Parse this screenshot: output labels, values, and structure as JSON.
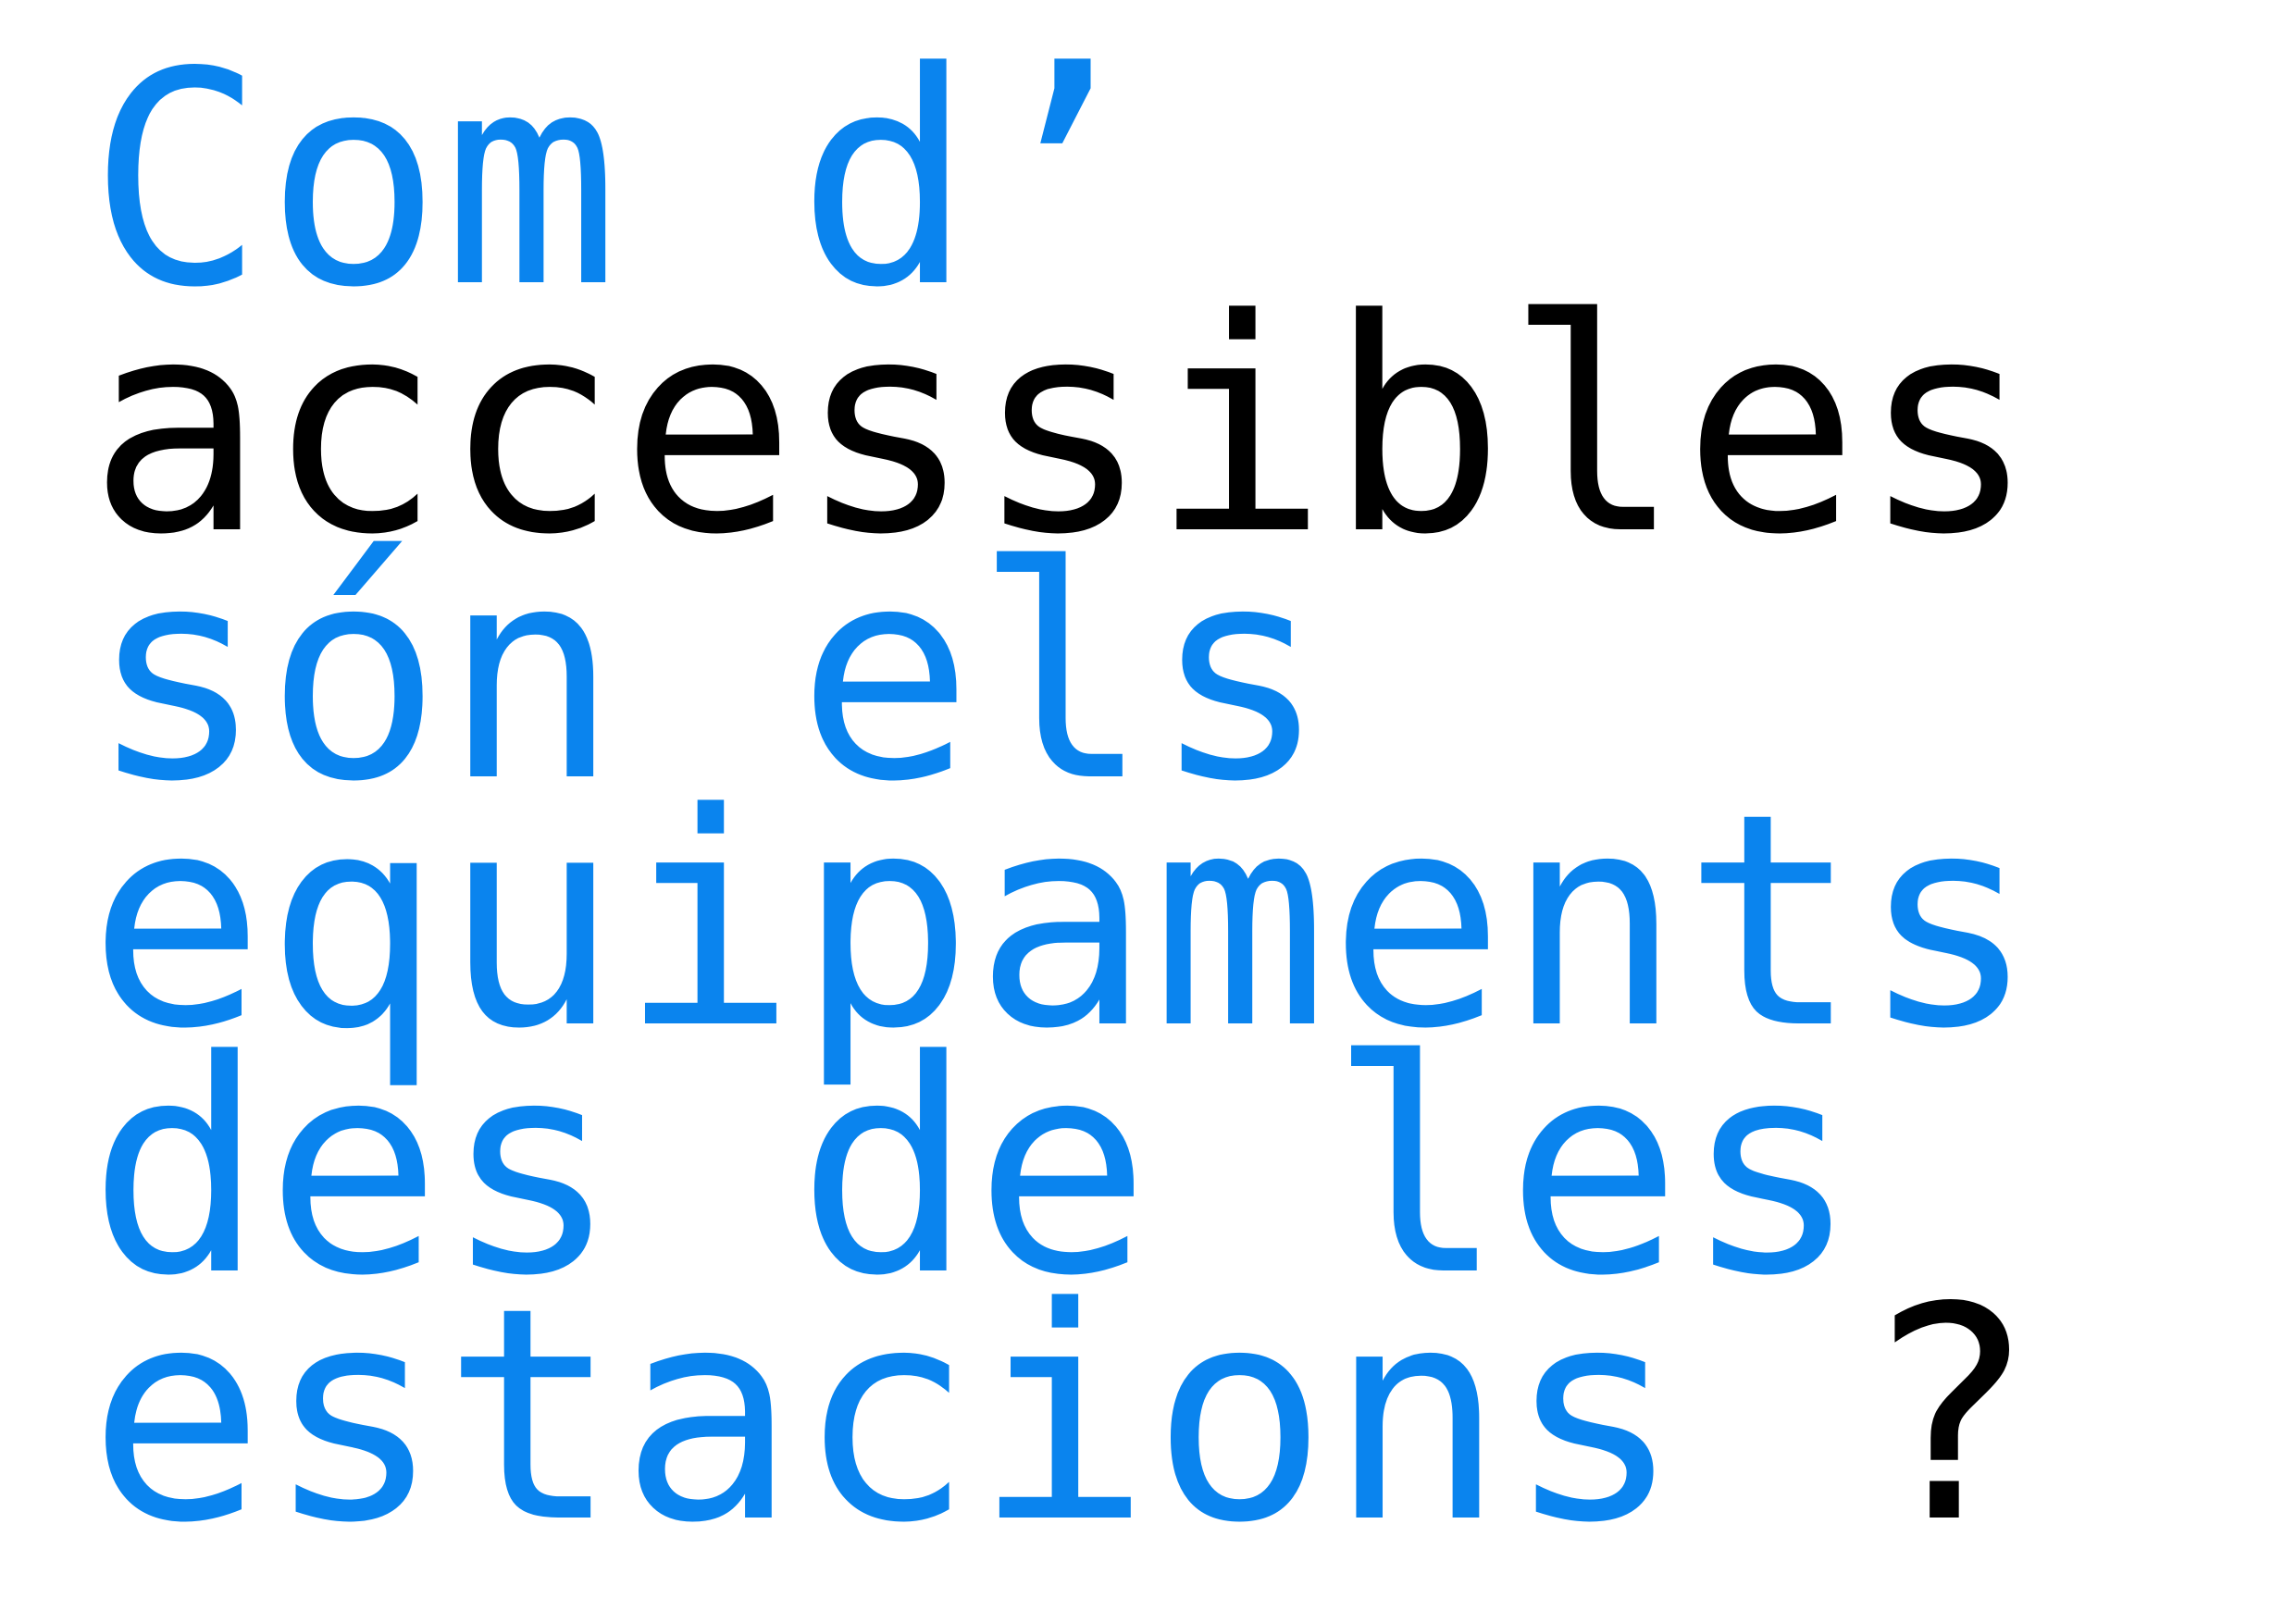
{
  "colors": {
    "accent": "#0a84ee",
    "text": "#000000",
    "background": "#ffffff"
  },
  "question": {
    "line1": {
      "word1": "Com",
      "word2": "d’"
    },
    "line2": {
      "word": "accessibles"
    },
    "line3": {
      "word1": "són",
      "word2": "els"
    },
    "line4": {
      "word": "equipaments"
    },
    "line5": {
      "word1": "des",
      "word2": "de",
      "word3": "les"
    },
    "line6": {
      "word": "estacions",
      "mark": "?"
    }
  }
}
